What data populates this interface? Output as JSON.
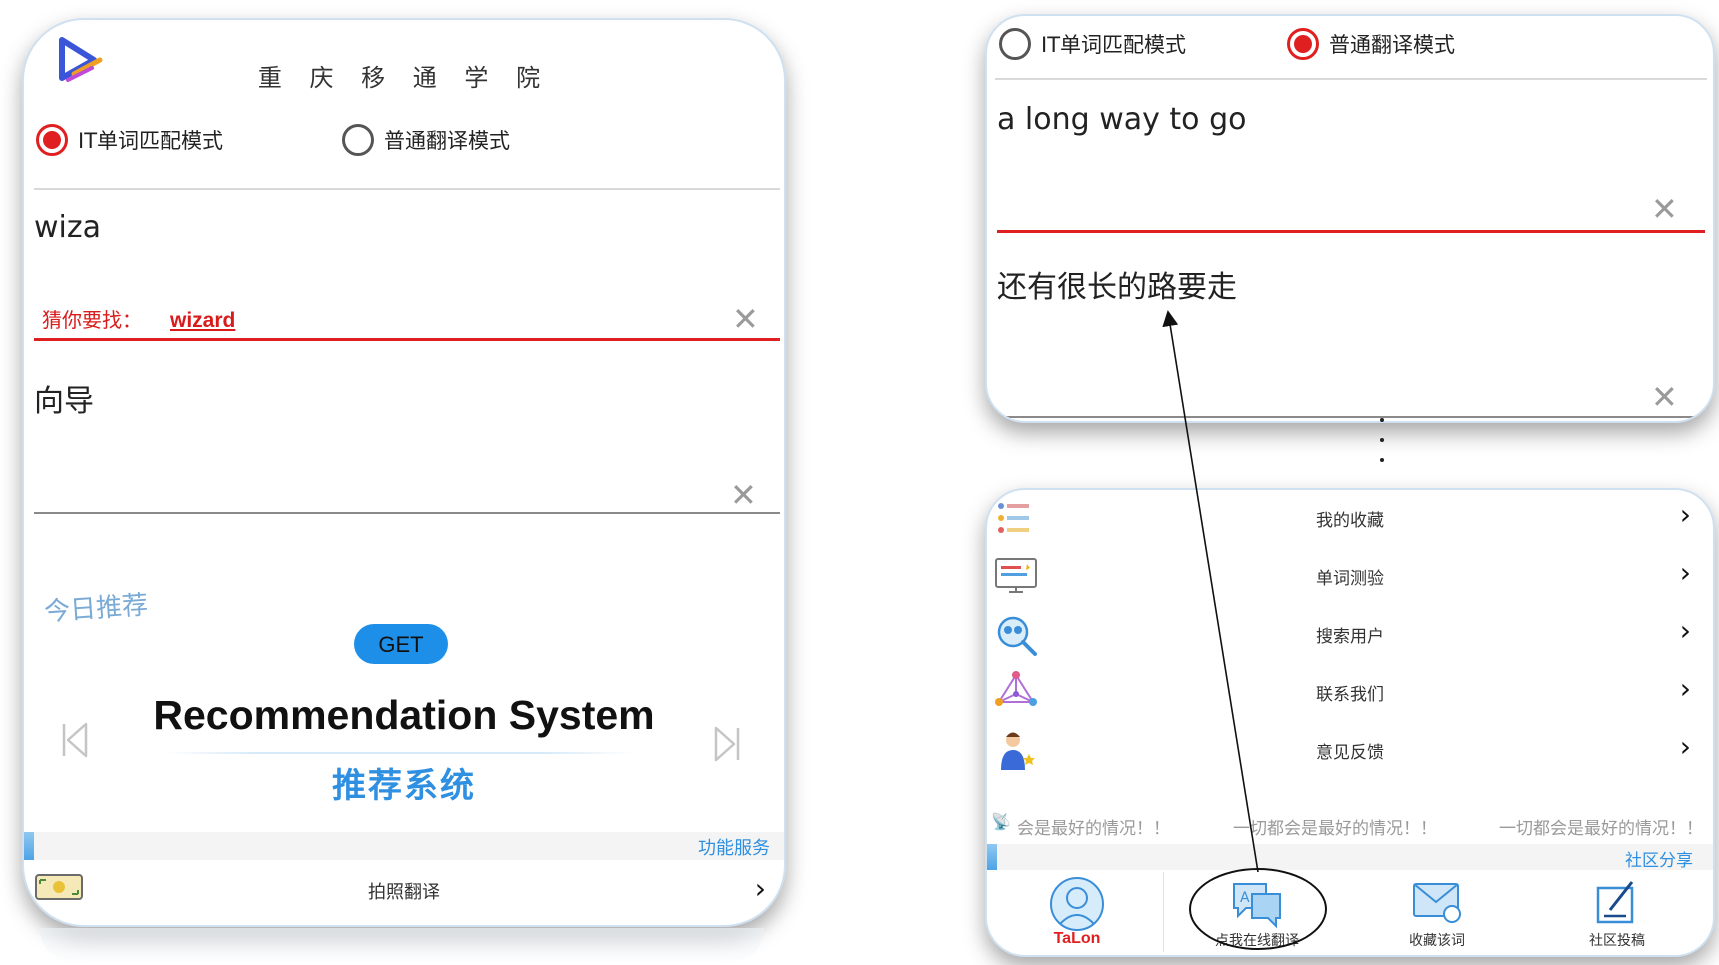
{
  "left_phone": {
    "school_name": "重 庆 移 通 学 院",
    "modes": [
      {
        "label": "IT单词匹配模式",
        "selected": true
      },
      {
        "label": "普通翻译模式",
        "selected": false
      }
    ],
    "input_value": "wiza",
    "guess_prefix": "猜你要找：",
    "guess_word": "wizard",
    "output_value": "向导",
    "today_label": "今日推荐",
    "get_button": "GET",
    "recommend_en": "Recommendation System",
    "recommend_cn": "推荐系统",
    "function_section": "功能服务",
    "menu_photo_translate": "拍照翻译"
  },
  "right_top_phone": {
    "modes": [
      {
        "label": "IT单词匹配模式",
        "selected": false
      },
      {
        "label": "普通翻译模式",
        "selected": true
      }
    ],
    "input_value": "a long way to go",
    "output_value": "还有很长的路要走"
  },
  "right_bottom_phone": {
    "menu": [
      {
        "label": "我的收藏",
        "icon": "favorites-list-icon"
      },
      {
        "label": "单词测验",
        "icon": "word-quiz-icon"
      },
      {
        "label": "搜索用户",
        "icon": "search-user-icon"
      },
      {
        "label": "联系我们",
        "icon": "contact-network-icon"
      },
      {
        "label": "意见反馈",
        "icon": "feedback-person-icon"
      }
    ],
    "marquee": [
      "会是最好的情况！！",
      "一切都会是最好的情况！！",
      "一切都会是最好的情况！！"
    ],
    "community_section": "社区分享",
    "tabs": [
      {
        "label": "TaLon"
      },
      {
        "label": "点我在线翻译"
      },
      {
        "label": "收藏该词"
      },
      {
        "label": "社区投稿"
      }
    ]
  },
  "colors": {
    "accent_red": "#e02020",
    "accent_blue": "#2f8fe0",
    "get_button": "#1e8fe8"
  }
}
